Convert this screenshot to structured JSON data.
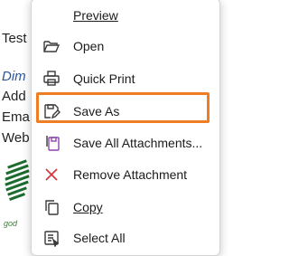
{
  "email_preview": {
    "lines": [
      "Test",
      "Dim",
      "Add",
      "Ema",
      "Web"
    ],
    "logo_caption": "god"
  },
  "menu": {
    "items": [
      {
        "label": "Preview",
        "mnemonic_index": 0,
        "icon": "none"
      },
      {
        "label": "Open",
        "mnemonic_index": 0,
        "icon": "folder-open-icon"
      },
      {
        "label": "Quick Print",
        "mnemonic_index": 7,
        "icon": "printer-icon"
      },
      {
        "label": "Save As",
        "mnemonic_index": 1,
        "icon": "save-as-icon"
      },
      {
        "label": "Save All Attachments...",
        "mnemonic_index": 20,
        "icon": "save-all-attachments-icon"
      },
      {
        "label": "Remove Attachment",
        "mnemonic_index": 4,
        "icon": "close-icon"
      },
      {
        "label": "Copy",
        "mnemonic_index": 0,
        "icon": "copy-icon"
      },
      {
        "label": "Select All",
        "mnemonic_index": 8,
        "icon": "select-all-icon"
      }
    ]
  },
  "colors": {
    "highlight_border": "#f07d22",
    "icon_stroke": "#3a3a3a",
    "remove_icon": "#d13438",
    "accent_blue": "#2f5597"
  }
}
